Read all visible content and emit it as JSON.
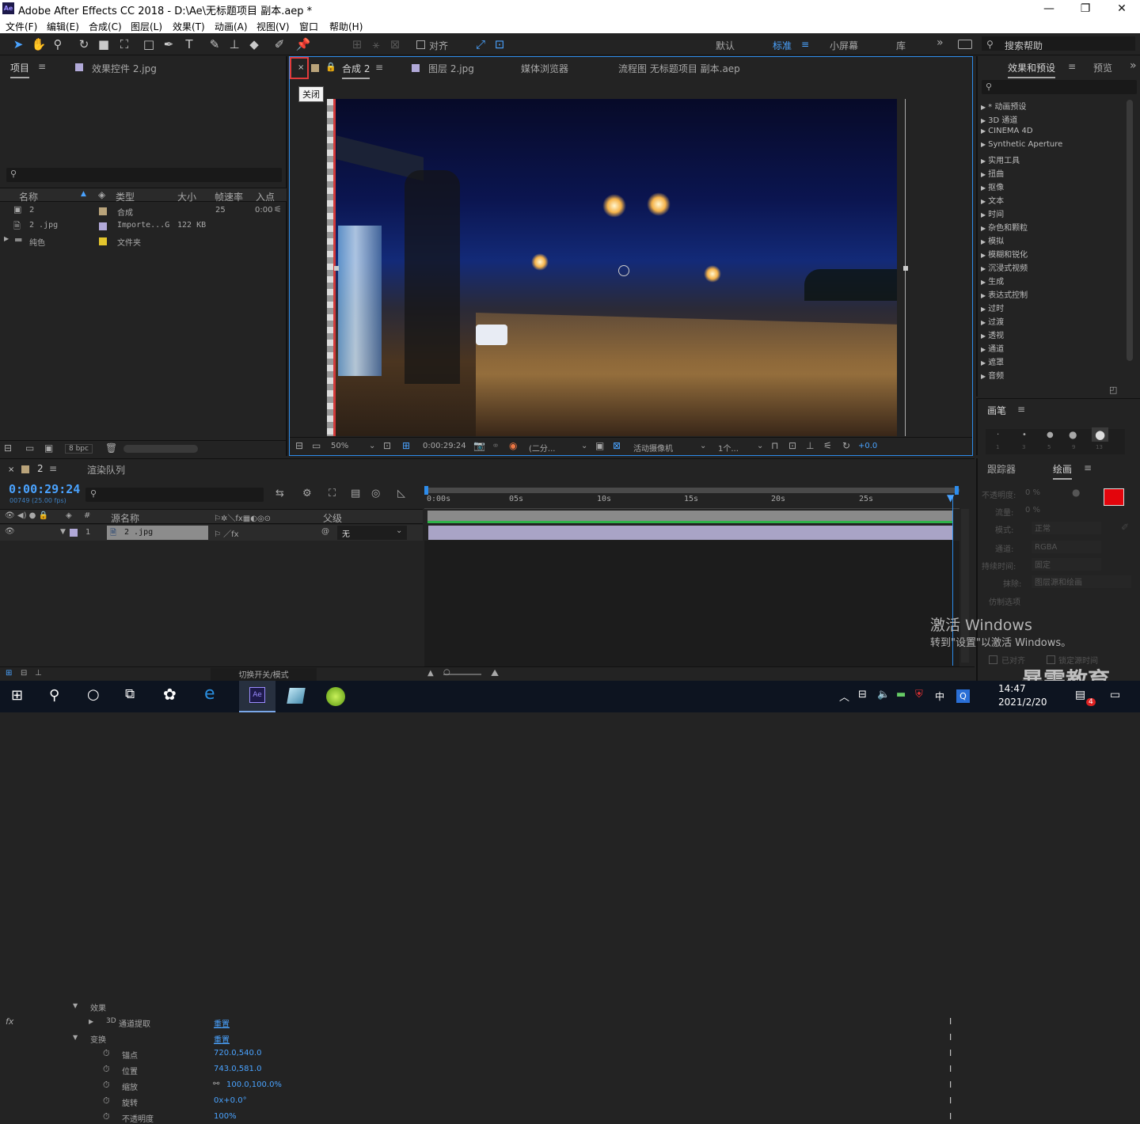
{
  "window": {
    "title": "Adobe After Effects CC 2018 - D:\\Ae\\无标题项目 副本.aep *",
    "logo": "Ae",
    "minimize": "—",
    "maximize": "❐",
    "close": "✕"
  },
  "menu": [
    "文件(F)",
    "编辑(E)",
    "合成(C)",
    "图层(L)",
    "效果(T)",
    "动画(A)",
    "视图(V)",
    "窗口",
    "帮助(H)"
  ],
  "toolbar": {
    "align_label": "对齐",
    "workspaces": [
      "默认",
      "标准",
      "小屏幕",
      "库"
    ],
    "active_workspace": "标准",
    "more": "»",
    "search_help": "搜索帮助"
  },
  "project_panel": {
    "tab_project": "项目",
    "tab_effects_controls": "效果控件 2.jpg",
    "columns": [
      "名称",
      "类型",
      "大小",
      "帧速率",
      "入点"
    ],
    "items": [
      {
        "name": "2",
        "type": "合成",
        "size": "",
        "fps": "25",
        "in": "0:00",
        "color": "#b9a37a"
      },
      {
        "name": "2 .jpg",
        "type": "Importe...G",
        "size": "122 KB",
        "fps": "",
        "in": "",
        "color": "#b1a9d8"
      },
      {
        "name": "纯色",
        "type": "文件夹",
        "size": "",
        "fps": "",
        "in": "",
        "color": "#e3c52d"
      }
    ],
    "bpc": "8 bpc"
  },
  "comp_panel": {
    "tabs": [
      "合成 2",
      "图层 2.jpg",
      "媒体浏览器",
      "流程图 无标题项目 副本.aep"
    ],
    "close_tooltip": "关闭",
    "comp_num": "2",
    "footer": {
      "zoom": "50%",
      "timecode": "0:00:29:24",
      "resolution": "(二分...",
      "camera": "活动摄像机",
      "views": "1个...",
      "exposure": "+0.0"
    }
  },
  "effects_panel": {
    "tab": "效果和预设",
    "tab2": "预览",
    "items": [
      "* 动画预设",
      "3D 通道",
      "CINEMA 4D",
      "Synthetic Aperture",
      "实用工具",
      "扭曲",
      "抠像",
      "文本",
      "时间",
      "杂色和颗粒",
      "模拟",
      "模糊和锐化",
      "沉浸式视频",
      "生成",
      "表达式控制",
      "过时",
      "过渡",
      "透视",
      "通道",
      "遮罩",
      "音频"
    ]
  },
  "brush_panel": {
    "tab": "画笔",
    "sizes": [
      "1",
      "3",
      "5",
      "9",
      "13"
    ]
  },
  "paint_panel": {
    "tab_tracker": "跟踪器",
    "tab_paint": "绘画",
    "opacity_label": "不透明度:",
    "opacity": "0 %",
    "flow_label": "流量:",
    "flow": "0 %",
    "mode_label": "模式:",
    "mode": "正常",
    "channel_label": "通道:",
    "channel": "RGBA",
    "duration_label": "持续时间:",
    "duration": "固定",
    "erase_label": "抹除:",
    "erase": "图层源和绘画",
    "clone_label": "仿制选项",
    "aligned": "已对齐",
    "lock_source": "锁定源时间"
  },
  "timeline": {
    "tab_comp": "2",
    "tab_render": "渲染队列",
    "timecode": "0:00:29:24",
    "frame_info": "00749 (25.00 fps)",
    "col_source": "源名称",
    "col_parent": "父级",
    "layer_num": "1",
    "layer_name": "2 .jpg",
    "parent_value": "无",
    "props": [
      {
        "label": "效果",
        "value": ""
      },
      {
        "label": "通道提取",
        "value": "重置",
        "prefix": "3D"
      },
      {
        "label": "变换",
        "value": "重置"
      },
      {
        "label": "锚点",
        "value": "720.0,540.0"
      },
      {
        "label": "位置",
        "value": "743.0,581.0"
      },
      {
        "label": "缩放",
        "value": "100.0,100.0%"
      },
      {
        "label": "旋转",
        "value": "0x+0.0°"
      },
      {
        "label": "不透明度",
        "value": "100%"
      }
    ],
    "ruler": [
      "0:00s",
      "05s",
      "10s",
      "15s",
      "20s",
      "25s"
    ],
    "footer_toggle": "切换开关/模式"
  },
  "watermark": {
    "line1": "激活 Windows",
    "line2": "转到\"设置\"以激活 Windows。",
    "brand": "暴需教育"
  },
  "taskbar": {
    "time": "14:47",
    "date": "2021/2/20",
    "ime": "中",
    "badge": "4"
  }
}
